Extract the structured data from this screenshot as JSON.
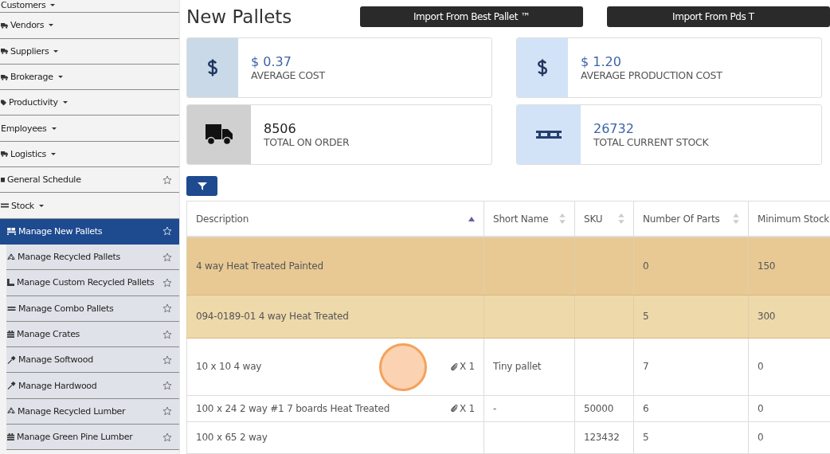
{
  "sidebar": {
    "items": [
      {
        "label": "Customers",
        "kind": "dropdown"
      },
      {
        "label": "Vendors",
        "kind": "dropdown"
      },
      {
        "label": "Suppliers",
        "kind": "dropdown"
      },
      {
        "label": "Brokerage",
        "kind": "dropdown"
      },
      {
        "label": "Productivity",
        "kind": "dropdown"
      },
      {
        "label": "Employees",
        "kind": "dropdown"
      },
      {
        "label": "Logistics",
        "kind": "dropdown"
      },
      {
        "label": "General Schedule",
        "kind": "link"
      },
      {
        "label": "Stock",
        "kind": "dropdown",
        "children": [
          {
            "label": "Manage New Pallets",
            "selected": true
          },
          {
            "label": "Manage Recycled Pallets",
            "selected": false
          },
          {
            "label": "Manage Custom Recycled Pallets",
            "selected": false
          },
          {
            "label": "Manage Combo Pallets",
            "selected": false
          },
          {
            "label": "Manage Crates",
            "selected": false
          },
          {
            "label": "Manage Softwood",
            "selected": false
          },
          {
            "label": "Manage Hardwood",
            "selected": false
          },
          {
            "label": "Manage Recycled Lumber",
            "selected": false
          },
          {
            "label": "Manage Green Pine Lumber",
            "selected": false
          }
        ]
      }
    ]
  },
  "page": {
    "title": "New Pallets",
    "buttons": [
      "Import From Best Pallet ™",
      "Import From Pds T"
    ]
  },
  "cards": [
    {
      "value": "$ 0.37",
      "label": "AVERAGE COST",
      "kind": "dollar",
      "color": "#c9d9e8"
    },
    {
      "value": "$ 1.20",
      "label": "AVERAGE PRODUCTION COST",
      "kind": "dollar",
      "color": "#d3e3f7"
    },
    {
      "value": "8506",
      "label": "TOTAL ON ORDER",
      "kind": "truck",
      "color": "#d0d0d0"
    },
    {
      "value": "26732",
      "label": "TOTAL CURRENT STOCK",
      "kind": "pallet",
      "color": "#d3e3f7"
    }
  ],
  "table": {
    "columns": [
      {
        "label": "Description",
        "kind": "sortable",
        "sorted": true
      },
      {
        "label": "Short Name",
        "kind": "sortable",
        "sorted": false
      },
      {
        "label": "SKU",
        "kind": "sortable",
        "sorted": false
      },
      {
        "label": "Number Of Parts",
        "kind": "sortable",
        "sorted": false
      },
      {
        "label": "Minimum Stock",
        "kind": "plain"
      }
    ],
    "rows": [
      {
        "cells": [
          "4 way Heat Treated Painted",
          "",
          "",
          "0",
          "150"
        ],
        "color": "#e8c994"
      },
      {
        "cells": [
          "094-0189-01 4 way Heat Treated",
          "",
          "",
          "5",
          "300"
        ],
        "color": "#eed9ab"
      },
      {
        "cells": [
          "10 x 10 4 way",
          "Tiny pallet",
          "",
          "7",
          "0"
        ],
        "attachments": "X 1",
        "color": "#ffffff"
      },
      {
        "cells": [
          "100 x 24 2 way #1 7 boards Heat Treated",
          "-",
          "50000",
          "6",
          "0"
        ],
        "attachments": "X 1",
        "color": "#ffffff"
      },
      {
        "cells": [
          "100 x 65 2 way",
          "",
          "123432",
          "5",
          "0"
        ],
        "color": "#ffffff"
      }
    ]
  }
}
